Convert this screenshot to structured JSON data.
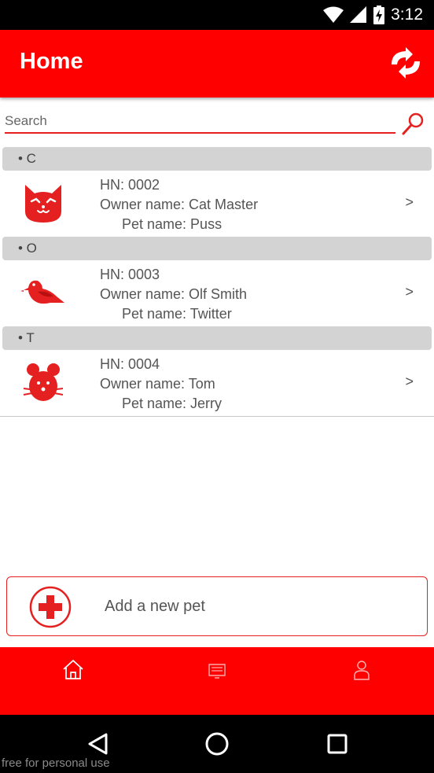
{
  "status_bar": {
    "time": "3:12"
  },
  "app_bar": {
    "title": "Home",
    "refresh_icon": "refresh-icon"
  },
  "search": {
    "placeholder": "Search",
    "value": "",
    "icon": "search-icon"
  },
  "sections": [
    {
      "letter": "• C",
      "items": [
        {
          "hn": "HN: 0002",
          "owner": "Owner name: Cat Master",
          "pet": "Pet name: Puss",
          "icon": "cat-icon",
          "chevron": ">"
        }
      ]
    },
    {
      "letter": "• O",
      "items": [
        {
          "hn": "HN: 0003",
          "owner": "Owner name: Olf Smith",
          "pet": "Pet name: Twitter",
          "icon": "bird-icon",
          "chevron": ">"
        }
      ]
    },
    {
      "letter": "• T",
      "items": [
        {
          "hn": "HN: 0004",
          "owner": "Owner name: Tom",
          "pet": "Pet name: Jerry",
          "icon": "mouse-icon",
          "chevron": ">"
        }
      ]
    }
  ],
  "add_button": {
    "label": "Add a new pet",
    "icon": "plus-circle-icon"
  },
  "tabs": [
    {
      "name": "home",
      "icon": "home-icon",
      "active": true
    },
    {
      "name": "list",
      "icon": "monitor-icon",
      "active": false
    },
    {
      "name": "profile",
      "icon": "person-icon",
      "active": false
    }
  ],
  "watermark": "free for personal use",
  "colors": {
    "primary": "#ff0000",
    "accent": "#e52020",
    "section_bg": "#d3d3d3",
    "text": "#555555"
  }
}
